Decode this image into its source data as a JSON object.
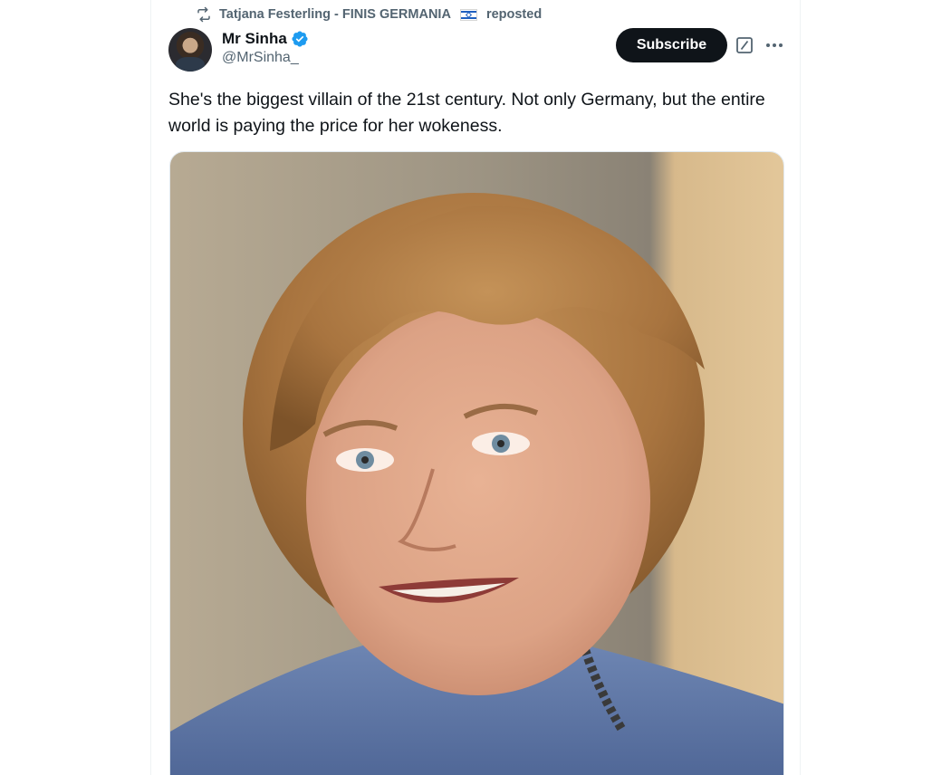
{
  "repost": {
    "icon": "repost-icon",
    "text": "Tatjana Festerling - FINIS GERMANIA",
    "flag": "israel-flag-icon",
    "suffix": "reposted"
  },
  "author": {
    "name": "Mr Sinha",
    "handle": "@MrSinha_",
    "verified": true,
    "verified_color": "#1d9bf0"
  },
  "actions": {
    "subscribe_label": "Subscribe"
  },
  "tweet": {
    "text": "She's the biggest villain of the 21st century. Not only Germany, but the entire world is paying the price for her wokeness."
  },
  "media": {
    "type": "photo",
    "subject": "portrait-photo"
  },
  "colors": {
    "text_primary": "#0f1419",
    "text_secondary": "#536471",
    "button_bg": "#0f1419",
    "button_text": "#ffffff"
  }
}
